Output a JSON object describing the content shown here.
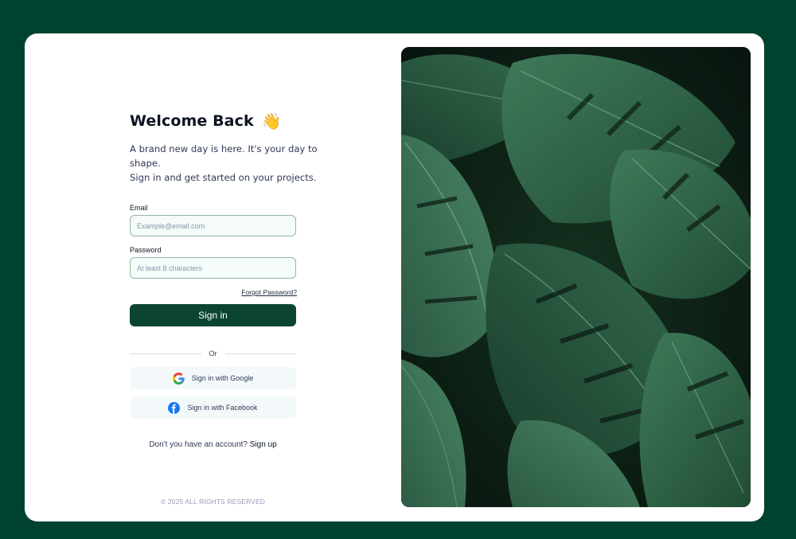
{
  "login": {
    "title": "Welcome Back",
    "wave_emoji": "👋",
    "subtitle_line1": "A brand new day is here. It's your day to shape.",
    "subtitle_line2": "Sign in and get started on your projects.",
    "email_label": "Email",
    "email_placeholder": "Example@email.com",
    "email_value": "",
    "password_label": "Password",
    "password_placeholder": "At least 8 characters",
    "password_value": "",
    "forgot_label": "Forgot Password?",
    "signin_label": "Sign in",
    "divider_label": "Or",
    "google_label": "Sign in with Google",
    "facebook_label": "Sign in with Facebook",
    "signup_prompt": "Don't you have an account?",
    "signup_link": "Sign up",
    "footer": "© 2025 ALL RIGHTS RESERVED"
  },
  "icons": {
    "google": "google-icon",
    "facebook": "facebook-icon"
  },
  "colors": {
    "background": "#004230",
    "primary_button": "#0b4433",
    "input_border": "#97b5a6",
    "input_bg": "#f4fbf8",
    "social_bg": "#f3f9fa"
  }
}
